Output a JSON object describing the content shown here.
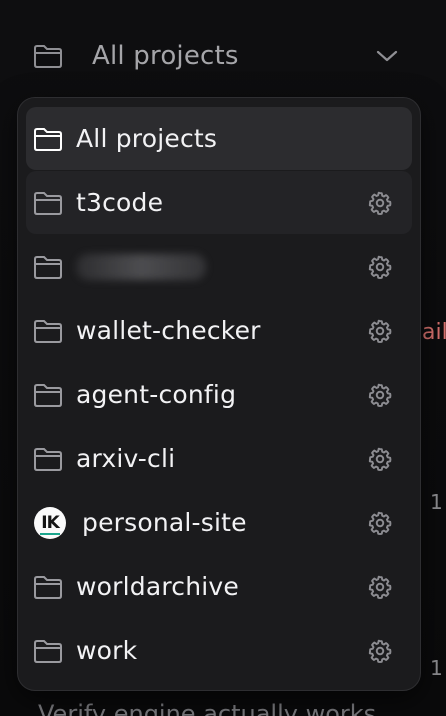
{
  "selector": {
    "label": "All projects"
  },
  "background": {
    "edge_text": "ail",
    "edge_numbers": [
      "1",
      "1"
    ],
    "bottom_text": "Verify engine actually works"
  },
  "dropdown": {
    "items": [
      {
        "label": "All projects",
        "icon": "folder-icon",
        "has_settings": false,
        "state": "selected"
      },
      {
        "label": "t3code",
        "icon": "folder-icon",
        "has_settings": true,
        "state": "hover"
      },
      {
        "label": "",
        "icon": "folder-icon",
        "has_settings": true,
        "state": "blurred"
      },
      {
        "label": "wallet-checker",
        "icon": "folder-icon",
        "has_settings": true
      },
      {
        "label": "agent-config",
        "icon": "folder-icon",
        "has_settings": true
      },
      {
        "label": "arxiv-cli",
        "icon": "folder-icon",
        "has_settings": true
      },
      {
        "label": "personal-site",
        "icon": "ik-avatar-icon",
        "avatar_text": "IK",
        "has_settings": true
      },
      {
        "label": "worldarchive",
        "icon": "folder-icon",
        "has_settings": true
      },
      {
        "label": "work",
        "icon": "folder-icon",
        "has_settings": true
      }
    ]
  }
}
